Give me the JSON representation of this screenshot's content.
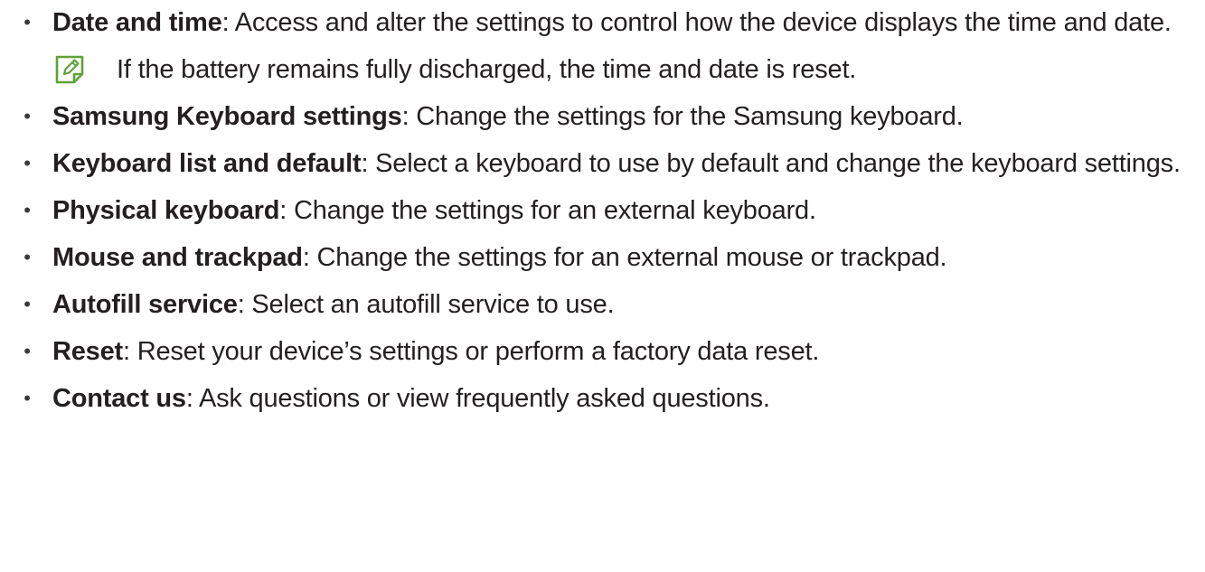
{
  "items": [
    {
      "term": "Date and time",
      "desc": ": Access and alter the settings to control how the device displays the time and date.",
      "note": "If the battery remains fully discharged, the time and date is reset."
    },
    {
      "term": "Samsung Keyboard settings",
      "desc": ": Change the settings for the Samsung keyboard."
    },
    {
      "term": "Keyboard list and default",
      "desc": ": Select a keyboard to use by default and change the keyboard settings."
    },
    {
      "term": "Physical keyboard",
      "desc": ": Change the settings for an external keyboard."
    },
    {
      "term": "Mouse and trackpad",
      "desc": ": Change the settings for an external mouse or trackpad."
    },
    {
      "term": "Autofill service",
      "desc": ": Select an autofill service to use."
    },
    {
      "term": "Reset",
      "desc": ": Reset your device’s settings or perform a factory data reset."
    },
    {
      "term": "Contact us",
      "desc": ": Ask questions or view frequently asked questions."
    }
  ],
  "bullet_glyph": "•",
  "note_icon": "note-pencil-icon",
  "colors": {
    "text": "#231f20",
    "note_icon": "#5fa13a"
  }
}
